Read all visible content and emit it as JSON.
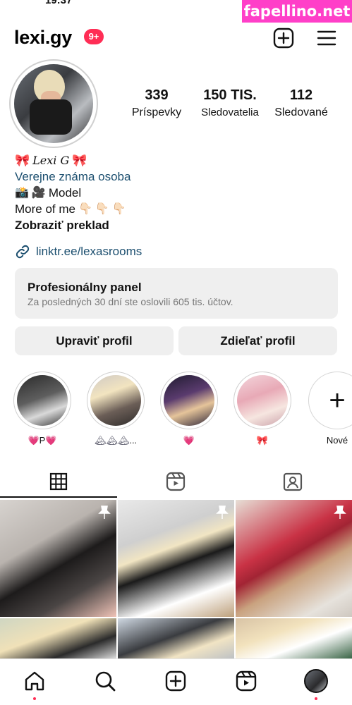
{
  "status_bar": {
    "time": "19:37"
  },
  "watermark": {
    "text": "fapellino.net",
    "color": "#ff3fc8"
  },
  "header": {
    "username": "lexi.gy",
    "notification_badge": "9+",
    "icons": [
      "new-post-icon",
      "menu-icon"
    ]
  },
  "profile": {
    "stats": [
      {
        "value": "339",
        "label": "Príspevky"
      },
      {
        "value": "150 TIS.",
        "label": "Sledovatelia"
      },
      {
        "value": "112",
        "label": "Sledované"
      }
    ],
    "bio": {
      "display_name": "Lexi G",
      "category": "Verejne známa osoba",
      "line_model": "Model",
      "line_more": "More of me",
      "translate": "Zobraziť preklad"
    },
    "link": "linktr.ee/lexasrooms"
  },
  "pro_panel": {
    "title": "Profesionálny panel",
    "subtitle": "Za posledných 30 dní ste oslovili 605 tis. účtov."
  },
  "buttons": {
    "edit": "Upraviť profil",
    "share": "Zdieľať profil"
  },
  "highlights": [
    {
      "caption": "P"
    },
    {
      "caption": "..."
    },
    {
      "caption": ""
    },
    {
      "caption": ""
    },
    {
      "caption": "Nové"
    }
  ],
  "tabs": [
    "grid-icon",
    "reels-icon",
    "tagged-icon"
  ],
  "bottom_nav": [
    "home-icon",
    "search-icon",
    "create-icon",
    "reels-icon",
    "profile-avatar"
  ],
  "colors": {
    "link": "#1c4f6f",
    "badge": "#ff2d55",
    "panel_bg": "#efefef"
  }
}
